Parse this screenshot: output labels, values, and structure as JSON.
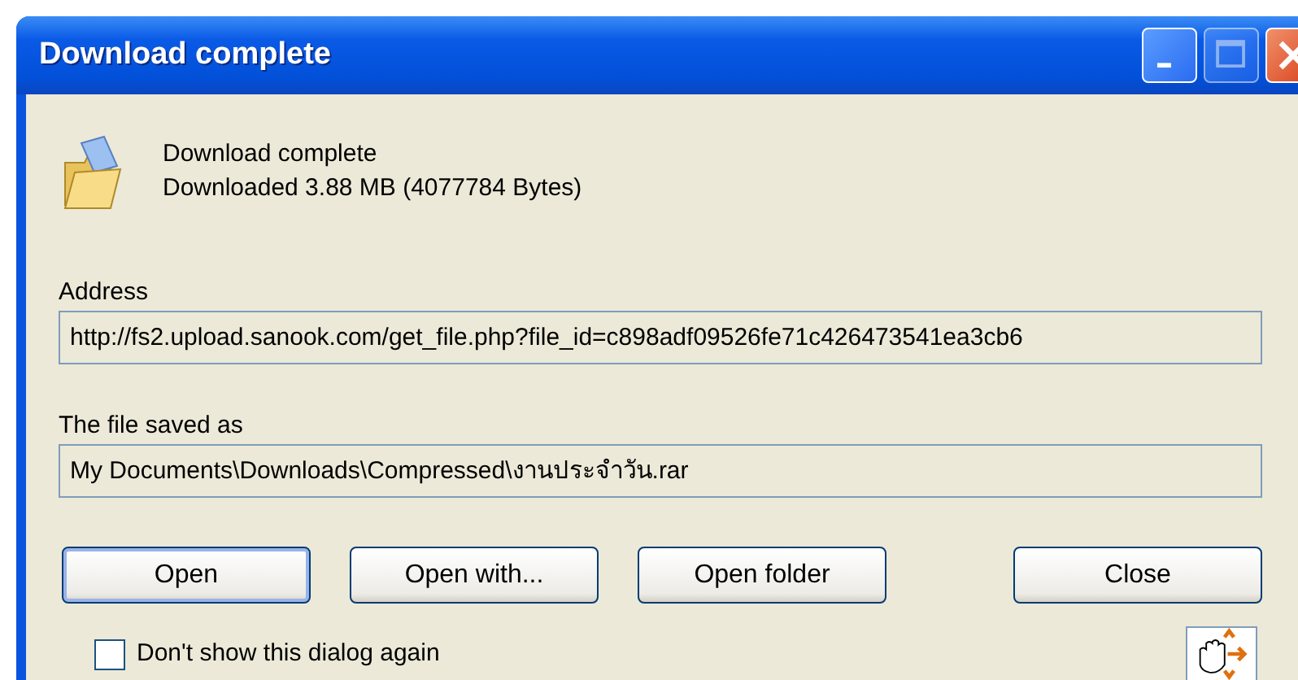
{
  "window": {
    "title": "Download complete",
    "title_buttons": [
      {
        "kind": "minimize",
        "disabled": false
      },
      {
        "kind": "maximize",
        "disabled": true
      },
      {
        "kind": "close",
        "disabled": false
      }
    ]
  },
  "summary": {
    "heading": "Download complete",
    "detail": "Downloaded 3.88  MB (4077784 Bytes)"
  },
  "address": {
    "label": "Address",
    "value": "http://fs2.upload.sanook.com/get_file.php?file_id=c898adf09526fe71c426473541ea3cb6"
  },
  "saved_as": {
    "label": "The file saved as",
    "value": "My Documents\\Downloads\\Compressed\\งานประจำวัน.rar"
  },
  "buttons": [
    {
      "label": "Open",
      "default": true
    },
    {
      "label": "Open with...",
      "default": false
    },
    {
      "label": "Open folder",
      "default": false
    },
    {
      "label": "Close",
      "default": false
    }
  ],
  "dont_show_again": {
    "label": "Don't show this dialog again",
    "checked": false
  }
}
